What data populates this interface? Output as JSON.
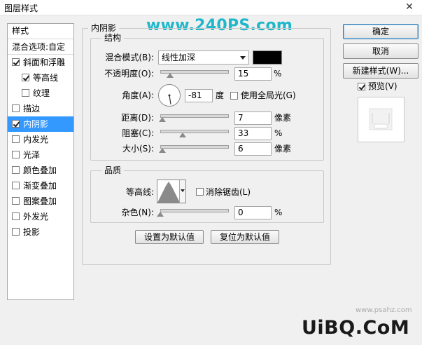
{
  "window": {
    "title": "图层样式",
    "close_glyph": "✕"
  },
  "watermark_top": "www.240PS.com",
  "styles_panel": {
    "header": "样式",
    "blend_options": "混合选项:自定",
    "items": [
      {
        "label": "斜面和浮雕",
        "checked": true,
        "indent": false,
        "selected": false
      },
      {
        "label": "等高线",
        "checked": true,
        "indent": true,
        "selected": false
      },
      {
        "label": "纹理",
        "checked": false,
        "indent": true,
        "selected": false
      },
      {
        "label": "描边",
        "checked": false,
        "indent": false,
        "selected": false
      },
      {
        "label": "内阴影",
        "checked": true,
        "indent": false,
        "selected": true
      },
      {
        "label": "内发光",
        "checked": false,
        "indent": false,
        "selected": false
      },
      {
        "label": "光泽",
        "checked": false,
        "indent": false,
        "selected": false
      },
      {
        "label": "颜色叠加",
        "checked": false,
        "indent": false,
        "selected": false
      },
      {
        "label": "渐变叠加",
        "checked": false,
        "indent": false,
        "selected": false
      },
      {
        "label": "图案叠加",
        "checked": false,
        "indent": false,
        "selected": false
      },
      {
        "label": "外发光",
        "checked": false,
        "indent": false,
        "selected": false
      },
      {
        "label": "投影",
        "checked": false,
        "indent": false,
        "selected": false
      }
    ]
  },
  "inner_shadow": {
    "group_title": "内阴影",
    "structure": {
      "title": "结构",
      "blend_mode_label": "混合模式(B):",
      "blend_mode_value": "线性加深",
      "shadow_color": "#000000",
      "opacity_label": "不透明度(O):",
      "opacity_value": "15",
      "opacity_unit": "%",
      "angle_label": "角度(A):",
      "angle_value": "-81",
      "angle_unit": "度",
      "global_light_label": "使用全局光(G)",
      "global_light_checked": false,
      "distance_label": "距离(D):",
      "distance_value": "7",
      "distance_unit": "像素",
      "choke_label": "阻塞(C):",
      "choke_value": "33",
      "choke_unit": "%",
      "size_label": "大小(S):",
      "size_value": "6",
      "size_unit": "像素"
    },
    "quality": {
      "title": "品质",
      "contour_label": "等高线:",
      "antialias_label": "消除锯齿(L)",
      "antialias_checked": false,
      "noise_label": "杂色(N):",
      "noise_value": "0",
      "noise_unit": "%"
    },
    "make_default": "设置为默认值",
    "reset_default": "复位为默认值"
  },
  "buttons": {
    "ok": "确定",
    "cancel": "取消",
    "new_style": "新建样式(W)..."
  },
  "preview": {
    "label": "预览(V)",
    "checked": true
  },
  "watermark_bottom": "UiBQ.CoM",
  "watermark_small": "www.psahz.com"
}
